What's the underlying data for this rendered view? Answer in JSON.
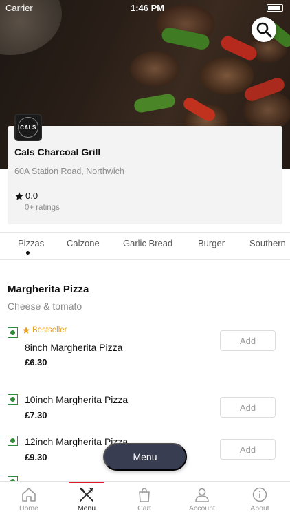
{
  "status_bar": {
    "carrier": "Carrier",
    "time": "1:46 PM"
  },
  "restaurant": {
    "logo_text": "CALS",
    "name": "Cals Charcoal Grill",
    "address": "60A Station Road, Northwich",
    "rating": "0.0",
    "ratings_count": "0+ ratings"
  },
  "categories": [
    {
      "label": "Pizzas",
      "selected": true
    },
    {
      "label": "Calzone",
      "selected": false
    },
    {
      "label": "Garlic Bread",
      "selected": false
    },
    {
      "label": "Burger",
      "selected": false
    },
    {
      "label": "Southern",
      "selected": false
    }
  ],
  "section": {
    "title": "Margherita Pizza",
    "subtitle": "Cheese & tomato"
  },
  "items": [
    {
      "badge": "Bestseller",
      "name": "8inch Margherita Pizza",
      "price": "£6.30",
      "add_label": "Add"
    },
    {
      "name": "10inch Margherita Pizza",
      "price": "£7.30",
      "add_label": "Add"
    },
    {
      "name": "12inch Margherita Pizza",
      "price": "£9.30",
      "add_label": "Add"
    }
  ],
  "menu_button": {
    "label": "Menu"
  },
  "tabbar": [
    {
      "label": "Home",
      "icon": "home-icon"
    },
    {
      "label": "Menu",
      "icon": "fork-knife-icon",
      "active": true
    },
    {
      "label": "Cart",
      "icon": "shopping-bag-icon"
    },
    {
      "label": "Account",
      "icon": "account-icon"
    },
    {
      "label": "About",
      "icon": "info-icon"
    }
  ],
  "colors": {
    "accent": "#e0182d",
    "veg": "#2e8b3a",
    "bestseller": "#e7a122",
    "menu_button": "#393d52"
  }
}
